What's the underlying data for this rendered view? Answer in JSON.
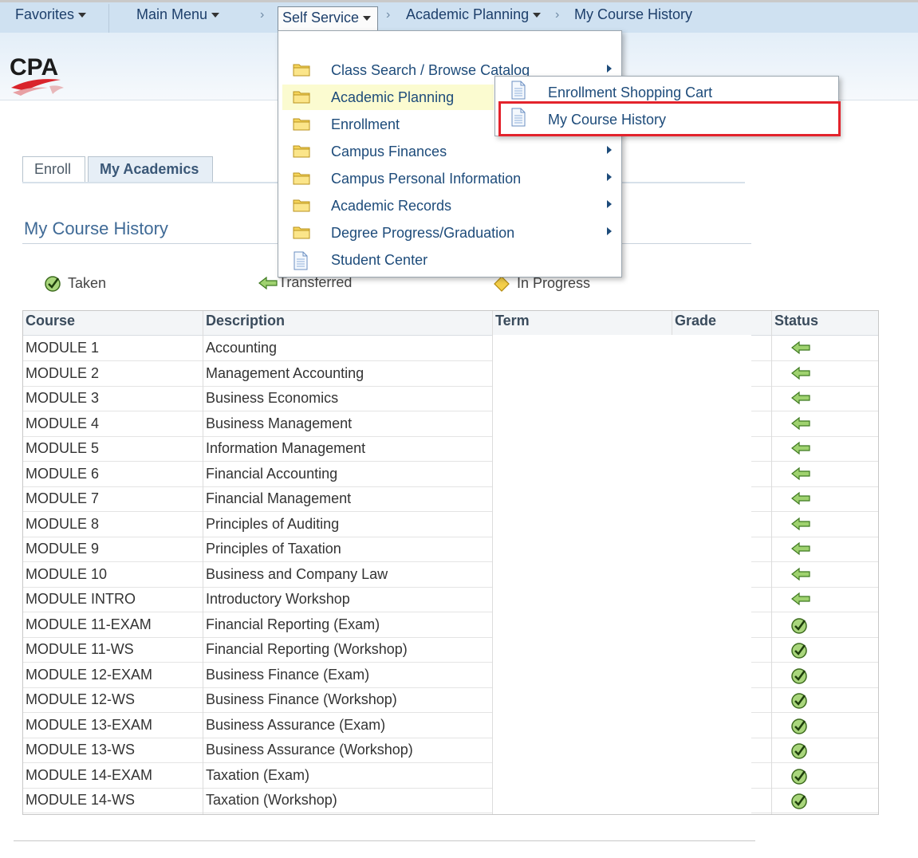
{
  "nav": {
    "favorites": "Favorites",
    "main_menu": "Main Menu",
    "self_service": "Self Service",
    "academic_planning": "Academic Planning",
    "current": "My Course History"
  },
  "logo": {
    "text": "CPA"
  },
  "tabs": [
    {
      "label": "Enroll"
    },
    {
      "label": "My Academics"
    }
  ],
  "page": {
    "title": "My Course History"
  },
  "legend": {
    "taken": "Taken",
    "transferred": "Transferred",
    "in_progress": "In Progress"
  },
  "table": {
    "headers": [
      "Course",
      "Description",
      "Term",
      "Grade",
      "Status"
    ],
    "rows": [
      {
        "course": "MODULE 1",
        "description": "Accounting",
        "status": "transferred"
      },
      {
        "course": "MODULE 2",
        "description": "Management Accounting",
        "status": "transferred"
      },
      {
        "course": "MODULE 3",
        "description": "Business Economics",
        "status": "transferred"
      },
      {
        "course": "MODULE 4",
        "description": "Business Management",
        "status": "transferred"
      },
      {
        "course": "MODULE 5",
        "description": "Information Management",
        "status": "transferred"
      },
      {
        "course": "MODULE 6",
        "description": "Financial Accounting",
        "status": "transferred"
      },
      {
        "course": "MODULE 7",
        "description": "Financial Management",
        "status": "transferred"
      },
      {
        "course": "MODULE 8",
        "description": "Principles of Auditing",
        "status": "transferred"
      },
      {
        "course": "MODULE 9",
        "description": "Principles of Taxation",
        "status": "transferred"
      },
      {
        "course": "MODULE 10",
        "description": "Business and Company Law",
        "status": "transferred"
      },
      {
        "course": "MODULE INTRO",
        "description": "Introductory Workshop",
        "status": "transferred"
      },
      {
        "course": "MODULE 11-EXAM",
        "description": "Financial Reporting (Exam)",
        "status": "taken"
      },
      {
        "course": "MODULE 11-WS",
        "description": "Financial Reporting (Workshop)",
        "status": "taken"
      },
      {
        "course": "MODULE 12-EXAM",
        "description": "Business Finance (Exam)",
        "status": "taken"
      },
      {
        "course": "MODULE 12-WS",
        "description": "Business Finance (Workshop)",
        "status": "taken"
      },
      {
        "course": "MODULE 13-EXAM",
        "description": "Business Assurance (Exam)",
        "status": "taken"
      },
      {
        "course": "MODULE 13-WS",
        "description": "Business Assurance (Workshop)",
        "status": "taken"
      },
      {
        "course": "MODULE 14-EXAM",
        "description": "Taxation (Exam)",
        "status": "taken"
      },
      {
        "course": "MODULE 14-WS",
        "description": "Taxation (Workshop)",
        "status": "taken"
      }
    ]
  },
  "self_service_menu": {
    "items": [
      {
        "label": "Class Search / Browse Catalog",
        "icon": "folder-icon",
        "submenu": true
      },
      {
        "label": "Academic Planning",
        "icon": "folder-icon",
        "submenu": true
      },
      {
        "label": "Enrollment",
        "icon": "folder-icon",
        "submenu": false
      },
      {
        "label": "Campus Finances",
        "icon": "folder-icon",
        "submenu": true
      },
      {
        "label": "Campus Personal Information",
        "icon": "folder-icon",
        "submenu": true
      },
      {
        "label": "Academic Records",
        "icon": "folder-icon",
        "submenu": true
      },
      {
        "label": "Degree Progress/Graduation",
        "icon": "folder-icon",
        "submenu": true
      },
      {
        "label": "Student Center",
        "icon": "page-icon",
        "submenu": false
      }
    ]
  },
  "academic_planning_menu": {
    "items": [
      {
        "label": "Enrollment Shopping Cart",
        "icon": "page-icon"
      },
      {
        "label": "My Course History",
        "icon": "page-icon"
      }
    ]
  },
  "colors": {
    "highlight_border": "#e3232c",
    "menu_hover": "#fbfbd0",
    "link": "#1d4b7a"
  }
}
